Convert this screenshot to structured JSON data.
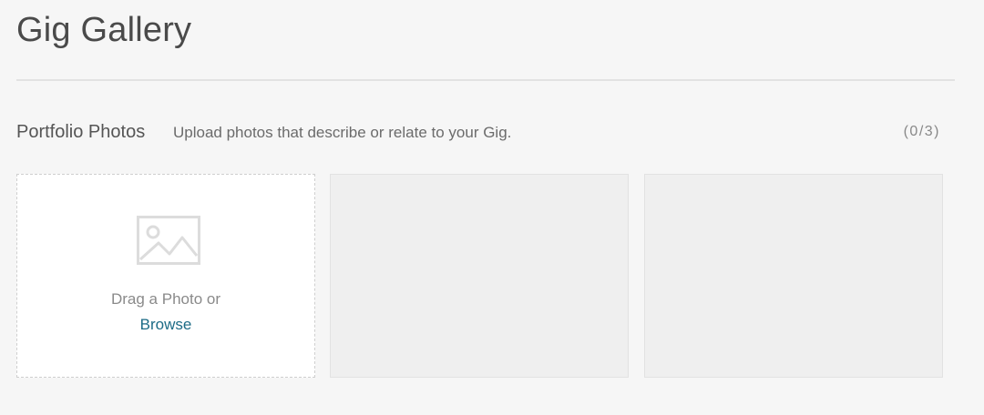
{
  "page": {
    "title": "Gig Gallery"
  },
  "portfolio": {
    "title": "Portfolio Photos",
    "description": "Upload photos that describe or relate to your Gig.",
    "counter": "(0/3)",
    "upload_slot": {
      "icon": "image-placeholder-icon",
      "drag_text": "Drag a Photo or",
      "browse_label": "Browse"
    }
  },
  "colors": {
    "background": "#f6f6f6",
    "link": "#1c6b86",
    "empty_slot": "#efefef"
  }
}
